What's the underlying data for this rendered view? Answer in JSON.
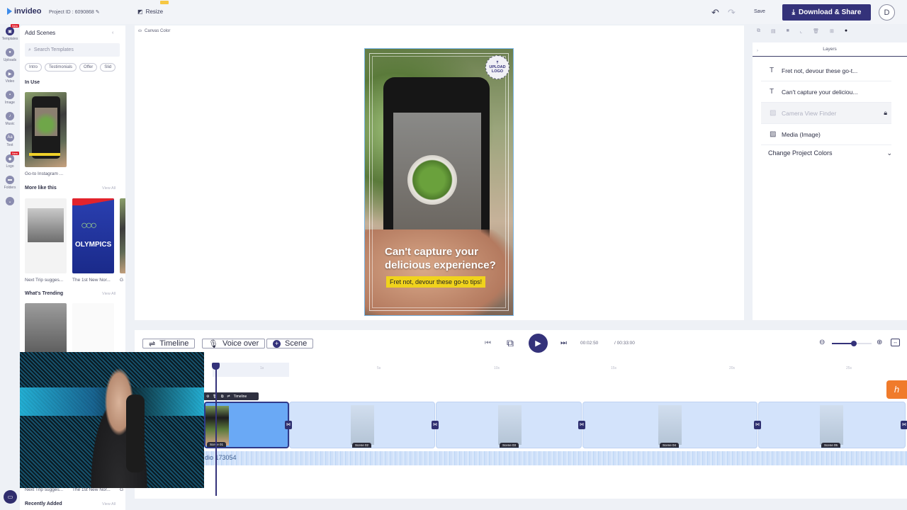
{
  "app": {
    "brand": "invideo",
    "project_id": "Project ID : 6090868",
    "resize_label": "Resize",
    "save_label": "Save",
    "download_label": "Download & Share",
    "avatar_initial": "D"
  },
  "rail": {
    "items": [
      {
        "label": "Templates",
        "icon": "template-icon",
        "badge": "New"
      },
      {
        "label": "Uploads",
        "icon": "upload-icon"
      },
      {
        "label": "Video",
        "icon": "video-icon"
      },
      {
        "label": "Image",
        "icon": "image-icon"
      },
      {
        "label": "Music",
        "icon": "music-icon"
      },
      {
        "label": "Text",
        "icon": "text-icon"
      },
      {
        "label": "Logo",
        "icon": "logo-icon",
        "badge": "New"
      },
      {
        "label": "Folders",
        "icon": "folder-icon"
      }
    ]
  },
  "scenes_panel": {
    "title": "Add Scenes",
    "search_placeholder": "Search Templates",
    "chips": [
      "Intro",
      "Testimonials",
      "Offer",
      "Slid"
    ],
    "in_use_title": "In Use",
    "in_use_caption": "Go-to Instagram ...",
    "more_title": "More like this",
    "more_view_all": "View All",
    "more_captions": [
      "Next Trip sugges...",
      "The 1st New Nor...",
      "G"
    ],
    "olympics_text": "OLYMPICS",
    "trending_title": "What's Trending",
    "trending_view_all": "View All",
    "trending_captions": [
      "Next Trip sugges...",
      "The 1st New Nor...",
      "G"
    ],
    "recent_title": "Recently Added",
    "recent_view_all": "View All"
  },
  "canvas": {
    "canvas_color_label": "Canvas Color",
    "upload_logo_line1": "UPLOAD",
    "upload_logo_line2": "LOGO",
    "headline": "Can't capture your delicious experience?",
    "subline": "Fret not, devour these go-to tips!"
  },
  "layers": {
    "title": "Layers",
    "items": [
      {
        "label": "Fret not, devour these go-t...",
        "icon": "text-icon",
        "locked": false
      },
      {
        "label": "Can't capture your deliciou...",
        "icon": "text-icon",
        "locked": false
      },
      {
        "label": "Camera View Finder",
        "icon": "image-icon",
        "locked": true
      },
      {
        "label": "Media (Image)",
        "icon": "image-icon",
        "locked": false
      }
    ],
    "change_colors_label": "Change Project Colors"
  },
  "playback": {
    "timeline_label": "Timeline",
    "voiceover_label": "Voice over",
    "scene_label": "Scene",
    "current_time": "00:02:50",
    "total_time": "/ 00:33:00",
    "zoom_level": 0.55
  },
  "timeline": {
    "ruler": [
      "1s",
      "5s",
      "10s",
      "15s",
      "20s",
      "25s"
    ],
    "scene_toolbar_label": "Timeline",
    "scenes": [
      "Scene 01",
      "Scene 02",
      "Scene 03",
      "Scene 04",
      "Scene 05"
    ],
    "audio_label": "dio 173054"
  },
  "colors": {
    "primary": "#34327a",
    "accent_orange": "#f07b2b",
    "highlight_yellow": "#f0d31c"
  }
}
